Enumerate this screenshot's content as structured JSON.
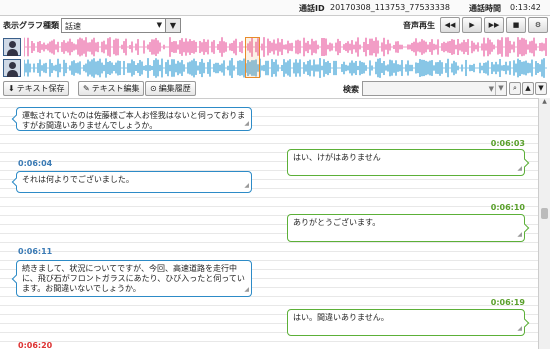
{
  "header": {
    "call_id_label": "通話ID",
    "call_id": "20170308_113753_77533338",
    "duration_label": "通話時間",
    "duration": "0:13:42"
  },
  "controls": {
    "graph_type_label": "表示グラフ種類",
    "graph_type_value": "話速",
    "playback_label": "音声再生",
    "buttons": [
      "rewind-icon",
      "play-icon",
      "fast-forward-icon",
      "stop-icon",
      "gear-icon"
    ]
  },
  "waveform": {
    "colors": {
      "speaker_a": "#e85ca0",
      "speaker_b": "#3a9fd6",
      "cursor": "#e98c2a"
    }
  },
  "toolbar": {
    "save_label": "テキスト保存",
    "edit_label": "テキスト編集",
    "history_label": "編集履歴",
    "search_label": "検索",
    "search_value": ""
  },
  "messages": [
    {
      "side": "left",
      "time": "",
      "text": "運転されていたのは佐藤様ご本人お怪我はないと伺っておりますがお間違いありませんでしょうか。"
    },
    {
      "side": "right",
      "time": "0:06:03",
      "text": "はい、けがはありません"
    },
    {
      "side": "left",
      "time": "0:06:04",
      "text": "それは何よりでございました。"
    },
    {
      "side": "right",
      "time": "0:06:10",
      "text": "ありがとうございます。"
    },
    {
      "side": "left",
      "time": "0:06:11",
      "text": "続きまして、状況についてですが、今回、高速道路を走行中に、飛び石がフロントガラスにあたり、ひび入ったと伺っています。お間違いないでしょうか。"
    },
    {
      "side": "right",
      "time": "0:06:19",
      "text": "はい。間違いありません。"
    },
    {
      "side": "left",
      "time": "0:06:20",
      "text": ""
    }
  ]
}
